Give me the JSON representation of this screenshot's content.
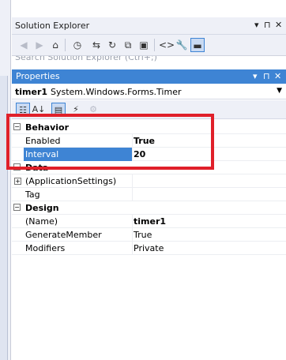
{
  "solution_explorer": {
    "title": "Solution Explorer",
    "pin": "▾",
    "pin2": "⊓",
    "close": "✕",
    "toolbar_icons": [
      "back-icon",
      "forward-icon",
      "home-icon",
      "history-icon",
      "sync-icon",
      "refresh-icon",
      "collapse-icon",
      "copy-icon",
      "code-icon",
      "wrench-icon",
      "preview-icon"
    ],
    "search_placeholder": "Search Solution Explorer (Ctrl+;)"
  },
  "properties": {
    "title": "Properties",
    "pin": "▾",
    "pin2": "⊓",
    "close": "✕",
    "object_name": "timer1",
    "object_type": "System.Windows.Forms.Timer",
    "categories": [
      {
        "name": "Behavior",
        "expander": "−",
        "rows": [
          {
            "name": "Enabled",
            "value": "True",
            "value_bold": true
          },
          {
            "name": "Interval",
            "value": "20",
            "value_bold": true,
            "selected": true
          }
        ]
      },
      {
        "name": "Data",
        "expander": "−",
        "rows": [
          {
            "name": "(ApplicationSettings)",
            "value": "",
            "sub_expander": "+"
          },
          {
            "name": "Tag",
            "value": ""
          }
        ]
      },
      {
        "name": "Design",
        "expander": "−",
        "rows": [
          {
            "name": "(Name)",
            "value": "timer1",
            "value_bold": true
          },
          {
            "name": "GenerateMember",
            "value": "True"
          },
          {
            "name": "Modifiers",
            "value": "Private"
          }
        ]
      }
    ]
  },
  "colors": {
    "accent": "#3e84d4",
    "highlight": "#e0202a",
    "panel_bg": "#eef0f7"
  }
}
